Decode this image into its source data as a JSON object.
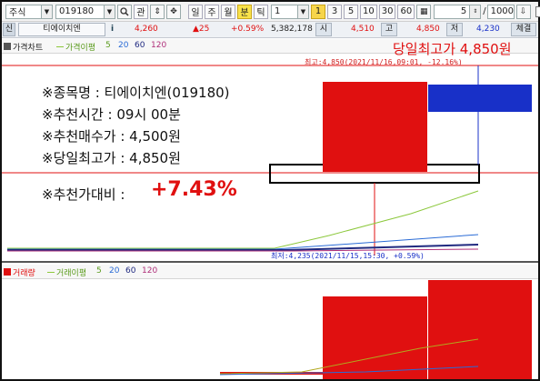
{
  "toolbar": {
    "market_select": "주식",
    "code_input": "019180",
    "search_icon": "search-icon",
    "tag_btn": "관",
    "periods": [
      "일",
      "주",
      "월",
      "년",
      "틱",
      "년"
    ],
    "tick_value": "1",
    "minute_active": "분",
    "minute_options": [
      "3",
      "5",
      "10",
      "30",
      "60"
    ],
    "count_value": "5",
    "amount_value": "1000",
    "amount_suffix": "/",
    "today_label": "당일"
  },
  "quote": {
    "tag": "신",
    "name": "티에이치엔",
    "info": "i",
    "price": "4,260",
    "change": "▲25",
    "rate": "+0.59%",
    "volume": "5,382,178",
    "open_label": "시",
    "open": "4,510",
    "high_label": "고",
    "high": "4,850",
    "low_label": "저",
    "low": "4,230",
    "trade_label": "체결"
  },
  "chart_legend": {
    "price_chart": "가격차트",
    "ma_label": "가격이평",
    "ma5": "5",
    "ma20": "20",
    "ma60": "60",
    "ma120": "120"
  },
  "volume_legend": {
    "volume": "거래량",
    "ma_label": "거래이평",
    "ma5": "5",
    "ma20": "20",
    "ma60": "60",
    "ma120": "120"
  },
  "annotations": {
    "headline": "당일최고가 4,850원",
    "high_marker": "최고:4,850(2021/11/16,09:01, -12.16%)",
    "low_marker": "최저:4,235(2021/11/15,15:30, +0.59%)"
  },
  "recommendation": {
    "name": "※종목명 : 티에이치엔(019180)",
    "time": "※추천시간 : 09시 00분",
    "price": "※추천매수가 : 4,500원",
    "high": "※당일최고가 : 4,850원",
    "ratio_label": "※추천가대비 :",
    "ratio_value": "+7.43%"
  },
  "colors": {
    "up": "#e01010",
    "down": "#1830c8",
    "ma5": "#8cc83c",
    "ma20": "#2a6bd6",
    "ma60": "#202a80",
    "ma120": "#b0307a"
  },
  "chart_data": {
    "type": "candlestick",
    "candles": [
      {
        "open": 4230,
        "high": 4850,
        "low": 4235,
        "close": 4850
      },
      {
        "open": 4850,
        "high": 4850,
        "low": 4230,
        "close": 4260
      }
    ],
    "volume": [
      4200000,
      5382178
    ]
  }
}
